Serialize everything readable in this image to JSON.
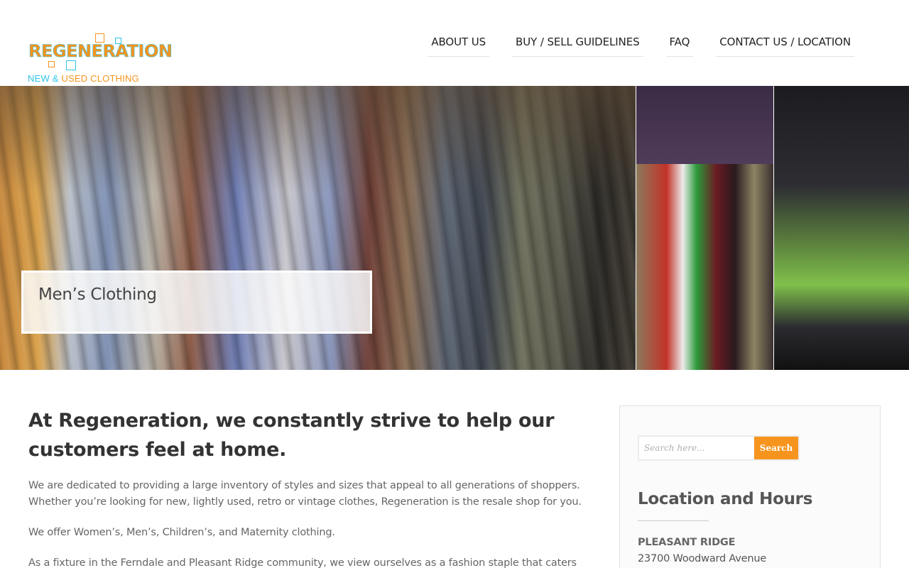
{
  "brand": {
    "logo_word": "REGENERATION",
    "logo_tagline_part1": "NEW & ",
    "logo_tagline_part2": "USED CLOTHING",
    "colors": {
      "orange": "#f7941d",
      "cyan": "#2fc3e8"
    }
  },
  "nav": {
    "items": [
      {
        "label": "ABOUT US"
      },
      {
        "label": "BUY / SELL GUIDELINES"
      },
      {
        "label": "FAQ"
      },
      {
        "label": "CONTACT US / LOCATION"
      }
    ]
  },
  "hero": {
    "caption": "Men’s Clothing",
    "slides": [
      "men-shirts-rack-photo",
      "womens-clothing-rack-photo",
      "shoes-display-photo"
    ]
  },
  "main": {
    "headline": "At Regeneration, we constantly strive to help our customers feel at home.",
    "paragraphs": [
      "We are dedicated to providing a large inventory of styles and sizes that appeal to all generations of shoppers. Whether you’re looking for new, lightly used, retro or vintage clothes, Regeneration is the resale shop for you.",
      "We offer Women’s, Men’s, Children’s, and Maternity clothing.",
      "As a fixture in the Ferndale and Pleasant Ridge community, we view ourselves as a fashion staple that caters to"
    ]
  },
  "sidebar": {
    "search": {
      "placeholder": "Search here...",
      "button_label": "Search"
    },
    "location_title": "Location and Hours",
    "location_name": "PLEASANT RIDGE",
    "address_line1": "23700 Woodward Avenue"
  }
}
